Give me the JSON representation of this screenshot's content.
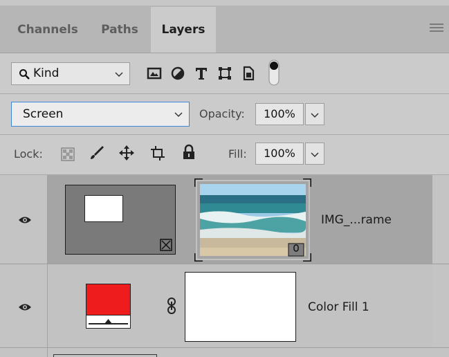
{
  "tabs": [
    {
      "label": "Channels",
      "active": false
    },
    {
      "label": "Paths",
      "active": false
    },
    {
      "label": "Layers",
      "active": true
    }
  ],
  "filter": {
    "label": "Kind",
    "icon": "search-icon"
  },
  "filter_icons": [
    "image-filter-icon",
    "adjustment-filter-icon",
    "type-filter-icon",
    "shape-filter-icon",
    "smart-object-filter-icon",
    "filter-toggle-icon"
  ],
  "blend": {
    "mode": "Screen",
    "opacity_label": "Opacity:",
    "opacity_value": "100%"
  },
  "lock": {
    "label": "Lock:",
    "fill_label": "Fill:",
    "fill_value": "100%"
  },
  "layers": [
    {
      "name": "IMG_...rame",
      "type": "frame",
      "selected": true
    },
    {
      "name": "Color Fill 1",
      "type": "fill",
      "selected": false,
      "color": "#ee1c1c"
    }
  ],
  "colors": {
    "panel": "#cbcbcb",
    "selected_row": "#a5a5a5",
    "accent": "#3d86d6"
  }
}
